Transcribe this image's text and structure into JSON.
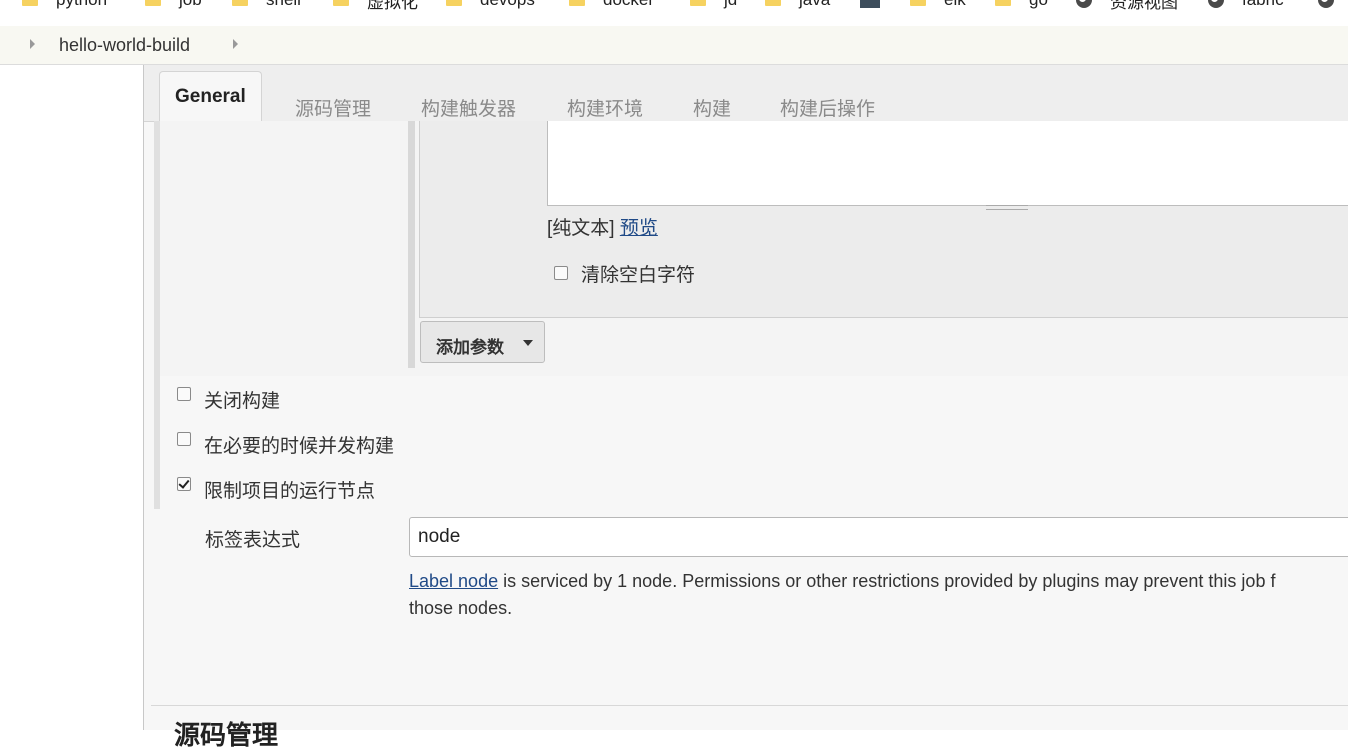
{
  "bookmarks": [
    {
      "label": "python",
      "icon": "folder-icon"
    },
    {
      "label": "job",
      "icon": "folder-icon"
    },
    {
      "label": "shell",
      "icon": "folder-icon"
    },
    {
      "label": "虚拟化",
      "icon": "folder-icon"
    },
    {
      "label": "devops",
      "icon": "folder-icon"
    },
    {
      "label": "docker",
      "icon": "folder-icon"
    },
    {
      "label": "jd",
      "icon": "folder-icon"
    },
    {
      "label": "java",
      "icon": "folder-icon"
    },
    {
      "label": "",
      "icon": "app-icon"
    },
    {
      "label": "elk",
      "icon": "folder-icon"
    },
    {
      "label": "go",
      "icon": "folder-icon"
    },
    {
      "label": "资源视图",
      "icon": "globe-icon"
    },
    {
      "label": "fabric",
      "icon": "globe-icon"
    },
    {
      "label": "",
      "icon": "globe-icon"
    }
  ],
  "breadcrumb": {
    "item": "hello-world-build"
  },
  "tabs": [
    "General",
    "源码管理",
    "构建触发器",
    "构建环境",
    "构建",
    "构建后操作"
  ],
  "param": {
    "format_prefix": "[纯文本]",
    "preview_link": "预览",
    "trim_label": "清除空白字符",
    "trim_checked": false,
    "add_param_label": "添加参数"
  },
  "options": [
    {
      "label": "关闭构建",
      "checked": false
    },
    {
      "label": "在必要的时候并发构建",
      "checked": false
    },
    {
      "label": "限制项目的运行节点",
      "checked": true
    }
  ],
  "label_expression": {
    "label": "标签表达式",
    "value": "node",
    "help_link": "Label node",
    "help_text": " is serviced by 1 node. Permissions or other restrictions provided by plugins may prevent this job f",
    "help_text2": "those nodes."
  },
  "next_section_title": "源码管理",
  "colors": {
    "link": "#204a87",
    "tab_bg": "#eeeeee",
    "folder": "#f6d260"
  }
}
